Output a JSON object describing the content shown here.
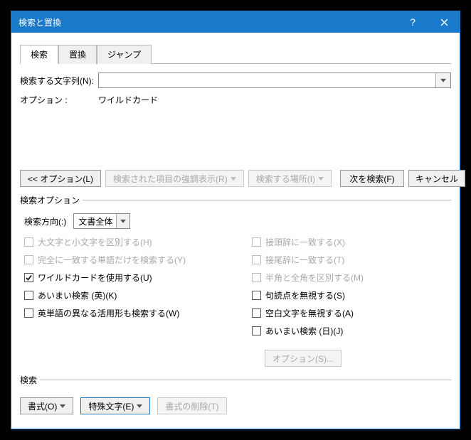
{
  "title": "検索と置換",
  "tabs": {
    "find": "検索",
    "replace": "置換",
    "jump": "ジャンプ"
  },
  "form": {
    "find_label": "検索する文字列(N):",
    "find_value": "",
    "options_label": "オプション :",
    "options_value": "ワイルドカード"
  },
  "buttons": {
    "less": "<< オプション(L)",
    "highlight": "検索された項目の強調表示(R)",
    "find_in": "検索する場所(I)",
    "find_next": "次を検索(F)",
    "cancel": "キャンセル"
  },
  "search_options": {
    "legend": "検索オプション",
    "direction_label": "検索方向(:)",
    "direction_value": "文書全体",
    "left": {
      "match_case": "大文字と小文字を区別する(H)",
      "whole_word": "完全に一致する単語だけを検索する(Y)",
      "wildcards": "ワイルドカードを使用する(U)",
      "sounds_like_en": "あいまい検索 (英)(K)",
      "word_forms": "英単語の異なる活用形も検索する(W)"
    },
    "right": {
      "prefix": "接頭辞に一致する(X)",
      "suffix": "接尾辞に一致する(T)",
      "half_full": "半角と全角を区別する(M)",
      "punct": "句読点を無視する(S)",
      "whitespace": "空白文字を無視する(A)",
      "sounds_like_jp": "あいまい検索 (日)(J)",
      "options_btn": "オプション(S)..."
    }
  },
  "bottom": {
    "legend": "検索",
    "format": "書式(O)",
    "special": "特殊文字(E)",
    "no_format": "書式の削除(T)"
  }
}
